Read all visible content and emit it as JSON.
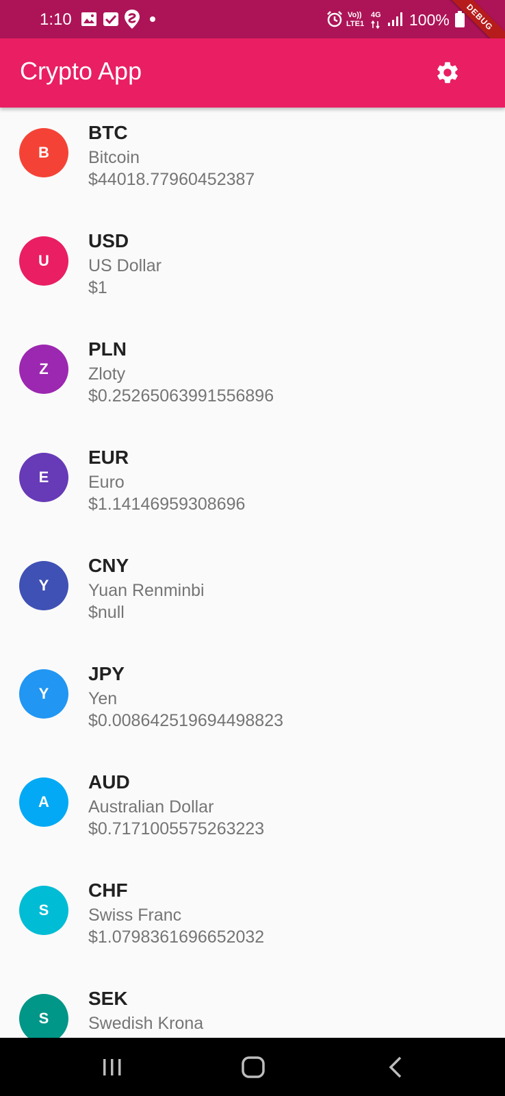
{
  "status_bar": {
    "time": "1:10",
    "battery": "100%",
    "network_top": "Vo))",
    "network_bottom": "LTE1",
    "signal_label": "4G",
    "debug_label": "DEBUG"
  },
  "app_bar": {
    "title": "Crypto App",
    "settings_icon": "gear-icon"
  },
  "currencies": [
    {
      "initial": "B",
      "code": "BTC",
      "name": "Bitcoin",
      "price": "$44018.77960452387",
      "color": "#f44336"
    },
    {
      "initial": "U",
      "code": "USD",
      "name": "US Dollar",
      "price": "$1",
      "color": "#e91e63"
    },
    {
      "initial": "Z",
      "code": "PLN",
      "name": "Zloty",
      "price": "$0.25265063991556896",
      "color": "#9c27b0"
    },
    {
      "initial": "E",
      "code": "EUR",
      "name": "Euro",
      "price": "$1.14146959308696",
      "color": "#673ab7"
    },
    {
      "initial": "Y",
      "code": "CNY",
      "name": "Yuan Renminbi",
      "price": "$null",
      "color": "#3f51b5"
    },
    {
      "initial": "Y",
      "code": "JPY",
      "name": "Yen",
      "price": "$0.008642519694498823",
      "color": "#2196f3"
    },
    {
      "initial": "A",
      "code": "AUD",
      "name": "Australian Dollar",
      "price": "$0.7171005575263223",
      "color": "#03a9f4"
    },
    {
      "initial": "S",
      "code": "CHF",
      "name": "Swiss Franc",
      "price": "$1.0798361696652032",
      "color": "#00bcd4"
    },
    {
      "initial": "S",
      "code": "SEK",
      "name": "Swedish Krona",
      "price": "",
      "color": "#009688"
    }
  ],
  "nav_bar": {
    "recents_icon": "recents-icon",
    "home_icon": "home-icon",
    "back_icon": "back-icon"
  }
}
